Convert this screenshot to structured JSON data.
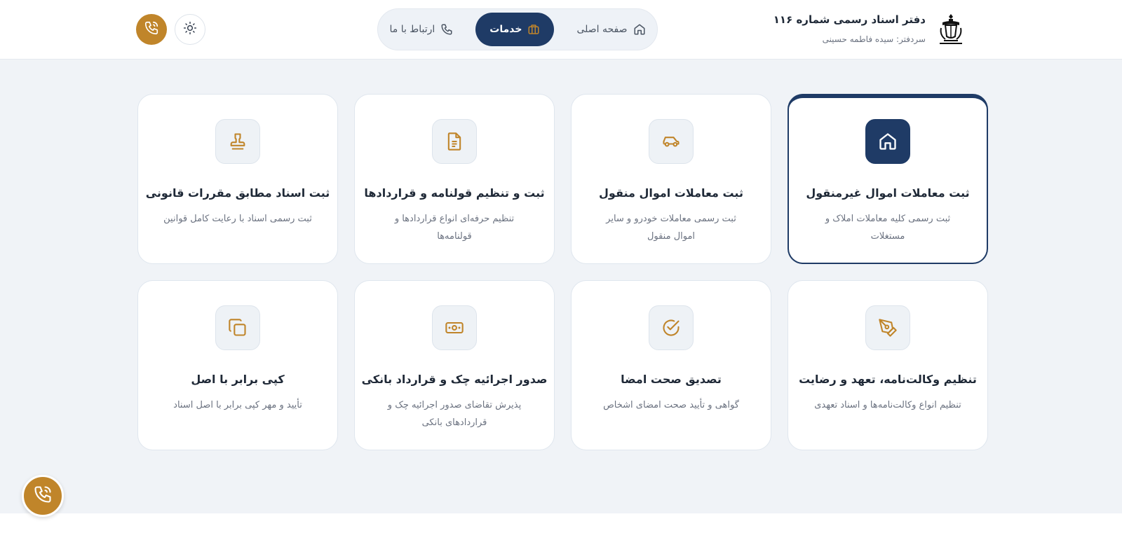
{
  "header": {
    "title": "دفتر اسناد رسمی شماره ۱۱۶",
    "subtitle": "سردفتر: سیده فاطمه حسینی",
    "logo_icon": "notary-emblem-icon"
  },
  "nav": {
    "items": [
      {
        "label": "صفحه اصلی",
        "icon": "home-icon",
        "active": false
      },
      {
        "label": "خدمات",
        "icon": "briefcase-icon",
        "active": true
      },
      {
        "label": "ارتباط با ما",
        "icon": "phone-icon",
        "active": false
      }
    ]
  },
  "actions": {
    "theme_icon": "sun-icon",
    "call_icon": "phone-call-icon"
  },
  "colors": {
    "primary": "#1f3b66",
    "accent": "#c0852a",
    "background": "#f0f3f7"
  },
  "services": [
    {
      "title": "ثبت معاملات اموال غیرمنقول",
      "desc": "ثبت رسمی کلیه معاملات املاک و مستغلات",
      "icon": "house-icon",
      "active": true
    },
    {
      "title": "ثبت معاملات اموال منقول",
      "desc": "ثبت رسمی معاملات خودرو و سایر اموال منقول",
      "icon": "car-icon",
      "active": false
    },
    {
      "title": "ثبت و تنظیم قولنامه و قراردادها",
      "desc": "تنظیم حرفه‌ای انواع قراردادها و قولنامه‌ها",
      "icon": "document-icon",
      "active": false
    },
    {
      "title": "ثبت اسناد مطابق مقررات قانونی",
      "desc": "ثبت رسمی اسناد با رعایت کامل قوانین",
      "icon": "stamp-icon",
      "active": false
    },
    {
      "title": "تنظیم وکالت‌نامه، تعهد و رضایت",
      "desc": "تنظیم انواع وکالت‌نامه‌ها و اسناد تعهدی",
      "icon": "pen-nib-icon",
      "active": false
    },
    {
      "title": "تصدیق صحت امضا",
      "desc": "گواهی و تأیید صحت امضای اشخاص",
      "icon": "check-circle-icon",
      "active": false
    },
    {
      "title": "صدور اجرائیه چک و قرارداد بانکی",
      "desc": "پذیرش تقاضای صدور اجرائیه چک و قراردادهای بانکی",
      "icon": "banknote-icon",
      "active": false
    },
    {
      "title": "کپی برابر با اصل",
      "desc": "تأیید و مهر کپی برابر با اصل اسناد",
      "icon": "copy-icon",
      "active": false
    }
  ],
  "floating": {
    "call_icon": "phone-call-icon"
  }
}
